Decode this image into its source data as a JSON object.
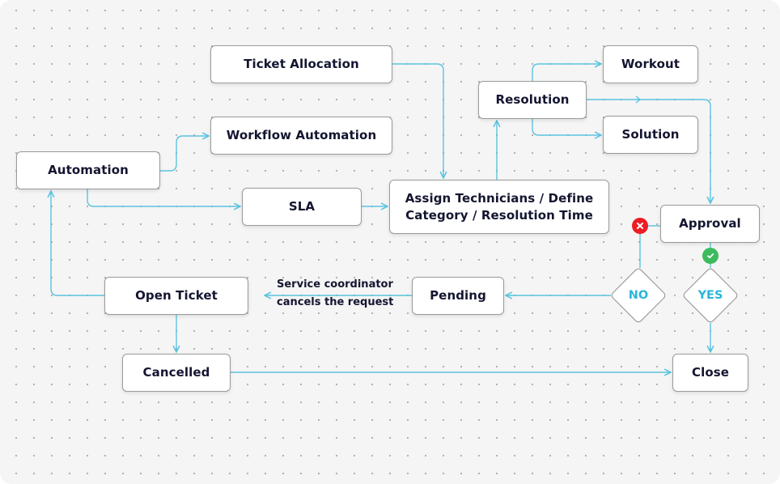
{
  "diagram": {
    "title": "",
    "colors": {
      "canvas": "#f5f5f5",
      "dot": "#b3b3b3",
      "connector": "#5bc3df",
      "node_border": "#9a9a9a",
      "node_text": "#141530",
      "decision_text": "#29b6d8",
      "reject_badge": "#ee1c24",
      "approve_badge": "#3dbb5e"
    },
    "nodes": {
      "ticket_allocation": "Ticket Allocation",
      "workflow_automation": "Workflow Automation",
      "automation": "Automation",
      "sla": "SLA",
      "assign_line1": "Assign Technicians / Define",
      "assign_line2": "Category / Resolution Time",
      "resolution": "Resolution",
      "workout": "Workout",
      "solution": "Solution",
      "approval": "Approval",
      "open_ticket": "Open Ticket",
      "pending": "Pending",
      "cancelled": "Cancelled",
      "close": "Close"
    },
    "decisions": {
      "no": "NO",
      "yes": "YES"
    },
    "badges": {
      "reject": "x-icon",
      "approve": "check-icon"
    },
    "annotations": {
      "cancel_line1": "Service coordinator",
      "cancel_line2": "cancels the request"
    },
    "edges": [
      {
        "from": "Automation",
        "to": "Workflow Automation"
      },
      {
        "from": "Automation",
        "to": "SLA"
      },
      {
        "from": "SLA",
        "to": "Assign Technicians / Define Category / Resolution Time"
      },
      {
        "from": "Ticket Allocation",
        "to": "Assign Technicians / Define Category / Resolution Time"
      },
      {
        "from": "Assign Technicians / Define Category / Resolution Time",
        "to": "Resolution"
      },
      {
        "from": "Resolution",
        "to": "Workout"
      },
      {
        "from": "Resolution",
        "to": "Solution"
      },
      {
        "from": "Resolution",
        "to": "Approval"
      },
      {
        "from": "Approval",
        "to": "NO",
        "badge": "reject"
      },
      {
        "from": "Approval",
        "to": "YES",
        "badge": "approve"
      },
      {
        "from": "NO",
        "to": "Pending"
      },
      {
        "from": "YES",
        "to": "Close"
      },
      {
        "from": "Pending",
        "to": "Open Ticket",
        "label": "Service coordinator cancels the request"
      },
      {
        "from": "Open Ticket",
        "to": "Automation"
      },
      {
        "from": "Open Ticket",
        "to": "Cancelled"
      },
      {
        "from": "Cancelled",
        "to": "Close"
      }
    ]
  }
}
